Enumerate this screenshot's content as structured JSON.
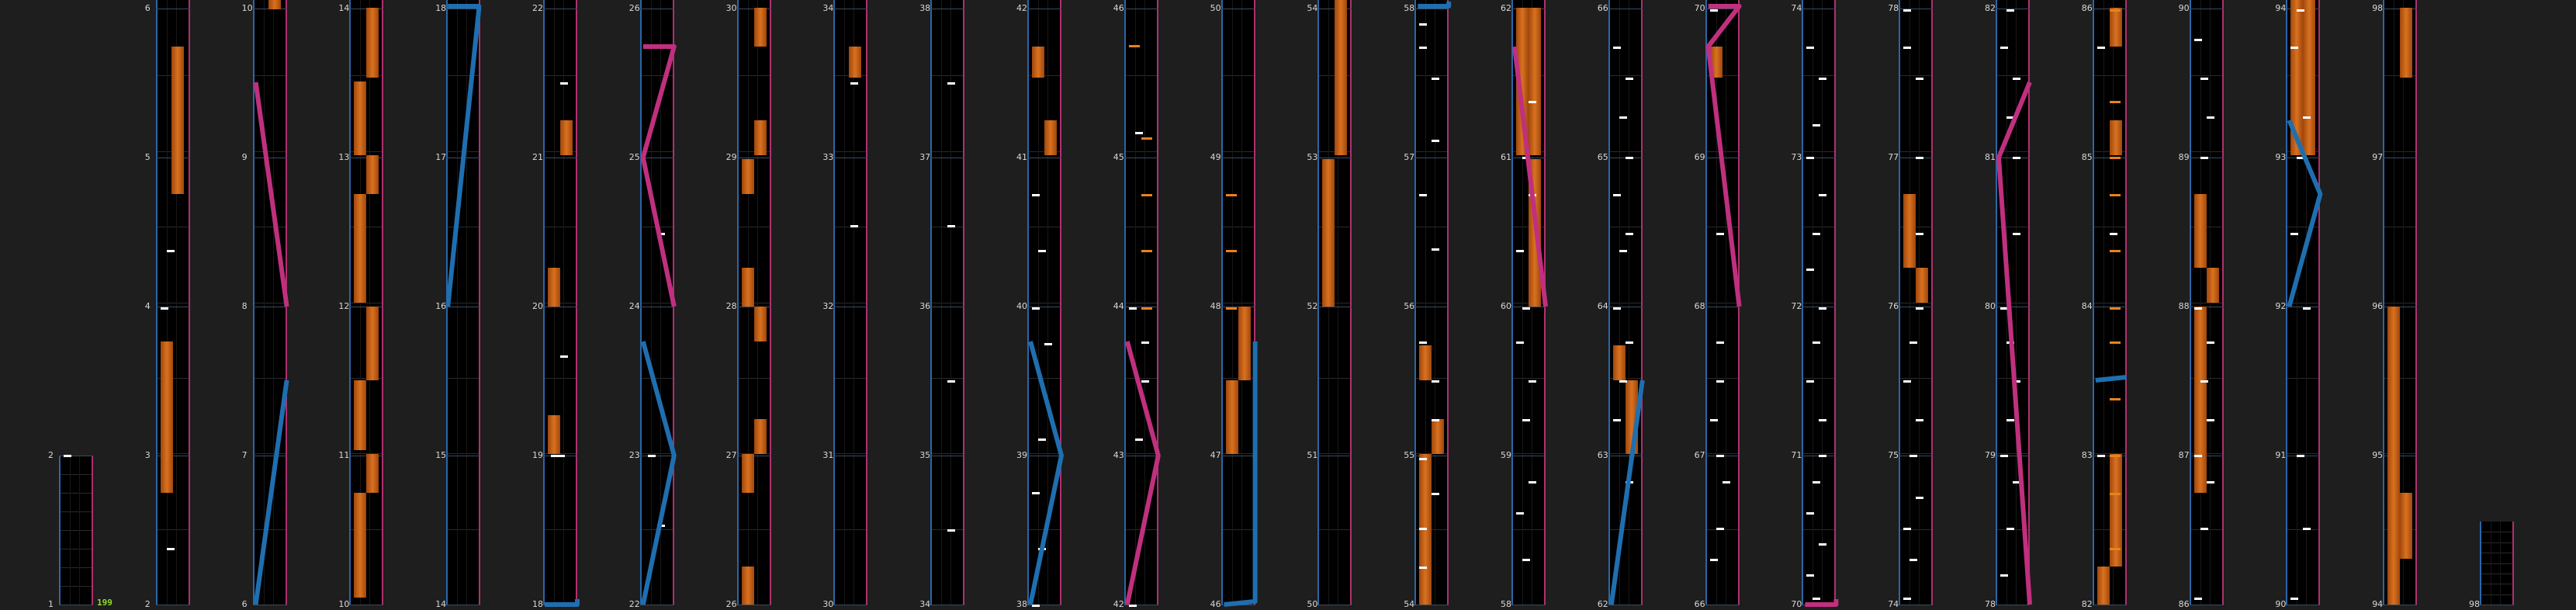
{
  "app": {
    "title": ""
  },
  "measure_labels": [
    "1",
    "2",
    "2",
    "3",
    "4",
    "5",
    "6",
    "6",
    "7",
    "8",
    "9",
    "10",
    "10",
    "11",
    "12",
    "13",
    "14",
    "14",
    "15",
    "16",
    "17",
    "18",
    "18",
    "19",
    "20",
    "21",
    "22",
    "22",
    "23",
    "24",
    "25",
    "26",
    "26",
    "27",
    "28",
    "29",
    "30",
    "30",
    "31",
    "32",
    "33",
    "34",
    "34",
    "35",
    "36",
    "37",
    "38",
    "38",
    "39",
    "40",
    "41",
    "42",
    "42",
    "43",
    "44",
    "45",
    "46",
    "46",
    "47",
    "48",
    "49",
    "50",
    "50",
    "51",
    "52",
    "53",
    "54",
    "54",
    "55",
    "56",
    "57",
    "58",
    "58",
    "59",
    "60",
    "61",
    "62",
    "62",
    "63",
    "64",
    "65",
    "66",
    "66",
    "67",
    "68",
    "69",
    "70",
    "70",
    "71",
    "72",
    "73",
    "74",
    "74",
    "75",
    "76",
    "77",
    "78",
    "78",
    "79",
    "80",
    "81",
    "82",
    "82",
    "83",
    "84",
    "85",
    "86",
    "86",
    "87",
    "88",
    "89",
    "90",
    "90",
    "91",
    "92",
    "93",
    "94",
    "94",
    "95",
    "96",
    "97",
    "98",
    "98"
  ],
  "combo": {
    "value": "199"
  },
  "colors": {
    "background": "#1e1e1e",
    "lane": "#000000",
    "left_border": "#2a66a8",
    "right_border": "#b0306e",
    "hold": "#d9721f",
    "slide_left": "#1f6fb0",
    "slide_right": "#c0307e",
    "combo": "#8fdc2a"
  }
}
